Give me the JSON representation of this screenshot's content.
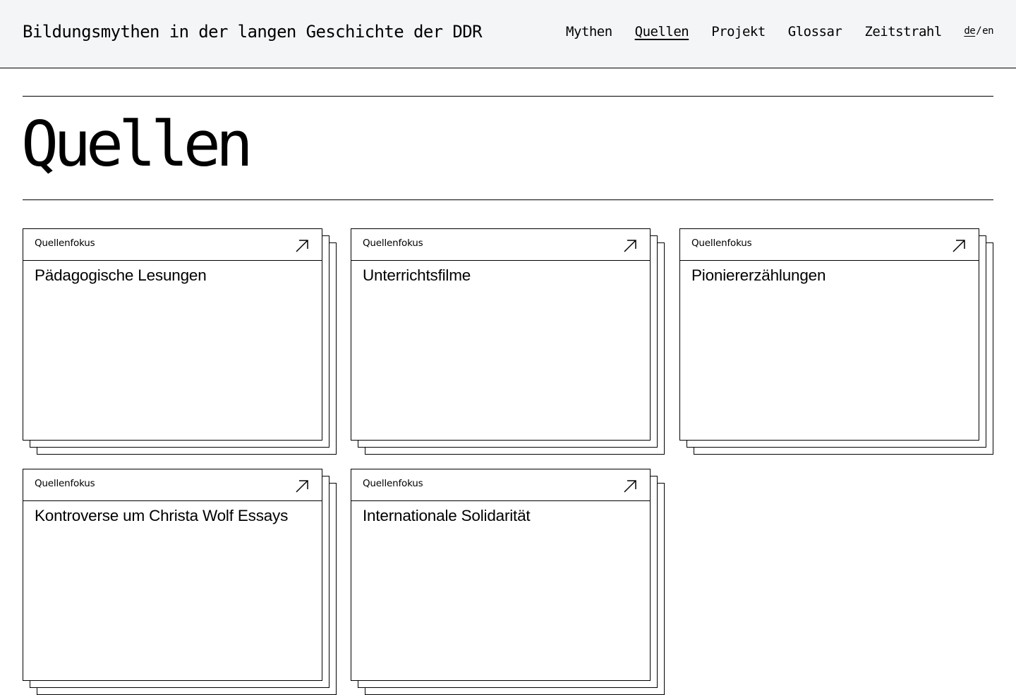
{
  "header": {
    "site_title": "Bildungsmythen in der langen Geschichte der DDR",
    "nav": [
      {
        "label": "Mythen",
        "active": false
      },
      {
        "label": "Quellen",
        "active": true
      },
      {
        "label": "Projekt",
        "active": false
      },
      {
        "label": "Glossar",
        "active": false
      },
      {
        "label": "Zeitstrahl",
        "active": false
      }
    ],
    "lang": {
      "de": "de",
      "separator": "/",
      "en": "en",
      "active": "de"
    }
  },
  "page": {
    "title": "Quellen"
  },
  "cards": [
    {
      "kicker": "Quellenfokus",
      "title": "Pädagogische Lesungen",
      "icon": "arrow-up-right-icon"
    },
    {
      "kicker": "Quellenfokus",
      "title": "Unterrichtsfilme",
      "icon": "arrow-up-right-icon"
    },
    {
      "kicker": "Quellenfokus",
      "title": "Pioniererzählungen",
      "icon": "arrow-up-right-icon"
    },
    {
      "kicker": "Quellenfokus",
      "title": "Kontroverse um Christa Wolf Essays",
      "icon": "arrow-up-right-icon"
    },
    {
      "kicker": "Quellenfokus",
      "title": "Internationale Solidarität",
      "icon": "arrow-up-right-icon"
    }
  ],
  "colors": {
    "header_bg": "#f4f5f7",
    "text": "#000000",
    "border": "#000000",
    "background": "#ffffff"
  }
}
